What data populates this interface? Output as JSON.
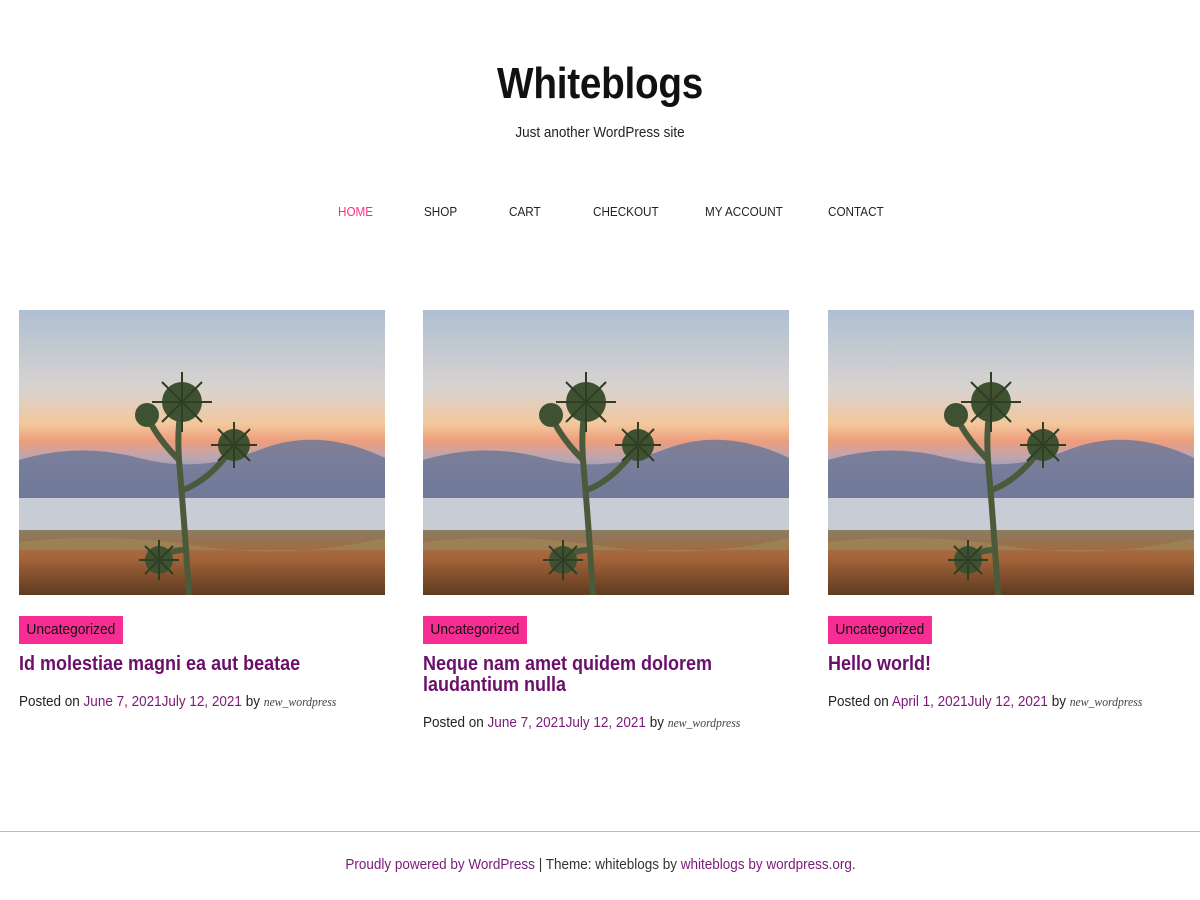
{
  "site": {
    "title": "Whiteblogs",
    "description": "Just another WordPress site"
  },
  "nav": {
    "items": [
      {
        "label": "HOME",
        "active": true
      },
      {
        "label": "SHOP",
        "active": false
      },
      {
        "label": "CART",
        "active": false
      },
      {
        "label": "CHECKOUT",
        "active": false
      },
      {
        "label": "MY ACCOUNT",
        "active": false
      },
      {
        "label": "CONTACT",
        "active": false
      }
    ]
  },
  "posts": [
    {
      "category": "Uncategorized",
      "title": "Id molestiae magni ea aut beatae",
      "posted_on": "Posted on",
      "date_published": "June 7, 2021",
      "date_updated": "July 12, 2021",
      "by": "by",
      "author": "new_wordpress"
    },
    {
      "category": "Uncategorized",
      "title": "Neque nam amet quidem dolorem laudantium nulla",
      "posted_on": "Posted on",
      "date_published": "June 7, 2021",
      "date_updated": "July 12, 2021",
      "by": "by",
      "author": "new_wordpress"
    },
    {
      "category": "Uncategorized",
      "title": "Hello world!",
      "posted_on": "Posted on",
      "date_published": "April 1, 2021",
      "date_updated": "July 12, 2021",
      "by": "by",
      "author": "new_wordpress"
    }
  ],
  "footer": {
    "powered": "Proudly powered by WordPress",
    "separator": " | ",
    "theme_prefix": "Theme: whiteblogs by ",
    "theme_link": "whiteblogs by wordpress.org",
    "suffix": "."
  },
  "colors": {
    "accent": "#ff2d80",
    "badge": "#f72d93",
    "link": "#7a1a7a",
    "title": "#6b0f6b"
  }
}
